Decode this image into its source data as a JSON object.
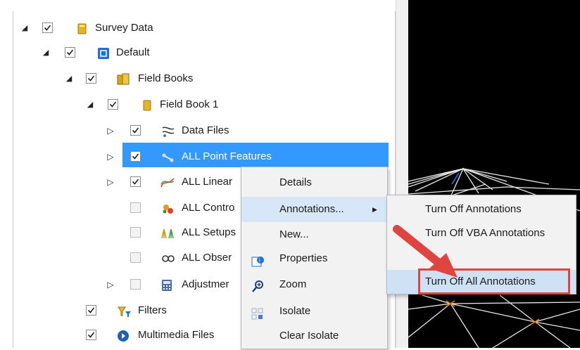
{
  "tree": {
    "nodes": [
      {
        "label": "Survey Data",
        "icon": "folder-icon",
        "expander": "open",
        "checked": true
      },
      {
        "label": "Default",
        "icon": "project-icon",
        "expander": "open",
        "checked": true
      },
      {
        "label": "Field Books",
        "icon": "books-icon",
        "expander": "open",
        "checked": true
      },
      {
        "label": "Field Book 1",
        "icon": "book-icon",
        "expander": "open",
        "checked": true
      },
      {
        "label": "Data Files",
        "icon": "data-files-icon",
        "expander": "closed",
        "checked": true
      },
      {
        "label": "ALL Point Features",
        "icon": "point-features-icon",
        "expander": "closed",
        "checked": true,
        "selected": true
      },
      {
        "label": "ALL Linear",
        "icon": "linear-features-icon",
        "expander": "closed",
        "checked": true
      },
      {
        "label": "ALL Contro",
        "icon": "control-icon",
        "expander": "none",
        "checked": false
      },
      {
        "label": "ALL Setups",
        "icon": "setups-icon",
        "expander": "none",
        "checked": false
      },
      {
        "label": "ALL Obser",
        "icon": "observations-icon",
        "expander": "none",
        "checked": false
      },
      {
        "label": "Adjustmer",
        "icon": "calculator-icon",
        "expander": "closed",
        "checked": false
      },
      {
        "label": "Filters",
        "icon": "filter-icon",
        "expander": "none",
        "checked": true
      },
      {
        "label": "Multimedia Files",
        "icon": "multimedia-icon",
        "expander": "none",
        "checked": true
      }
    ]
  },
  "context_menu": {
    "items": [
      {
        "label": "Details",
        "icon": ""
      },
      {
        "label": "Annotations...",
        "icon": "",
        "submenu_arrow": "▶"
      },
      {
        "label": "New...",
        "icon": ""
      },
      {
        "label": "Properties",
        "icon": "properties-icon"
      },
      {
        "label": "Zoom",
        "icon": "zoom-icon"
      },
      {
        "label": "Isolate",
        "icon": "isolate-icon"
      },
      {
        "label": "Clear Isolate",
        "icon": ""
      }
    ]
  },
  "submenu": {
    "items": [
      {
        "label": "Turn Off Annotations"
      },
      {
        "label": "Turn Off VBA Annotations"
      },
      {
        "label": "Turn Off All Annotations",
        "highlighted": true
      }
    ]
  },
  "colors": {
    "selection": "#3399ff",
    "highlight_box": "#e0443e",
    "callout_arrow": "#e0443e",
    "viewport": "#000000"
  }
}
